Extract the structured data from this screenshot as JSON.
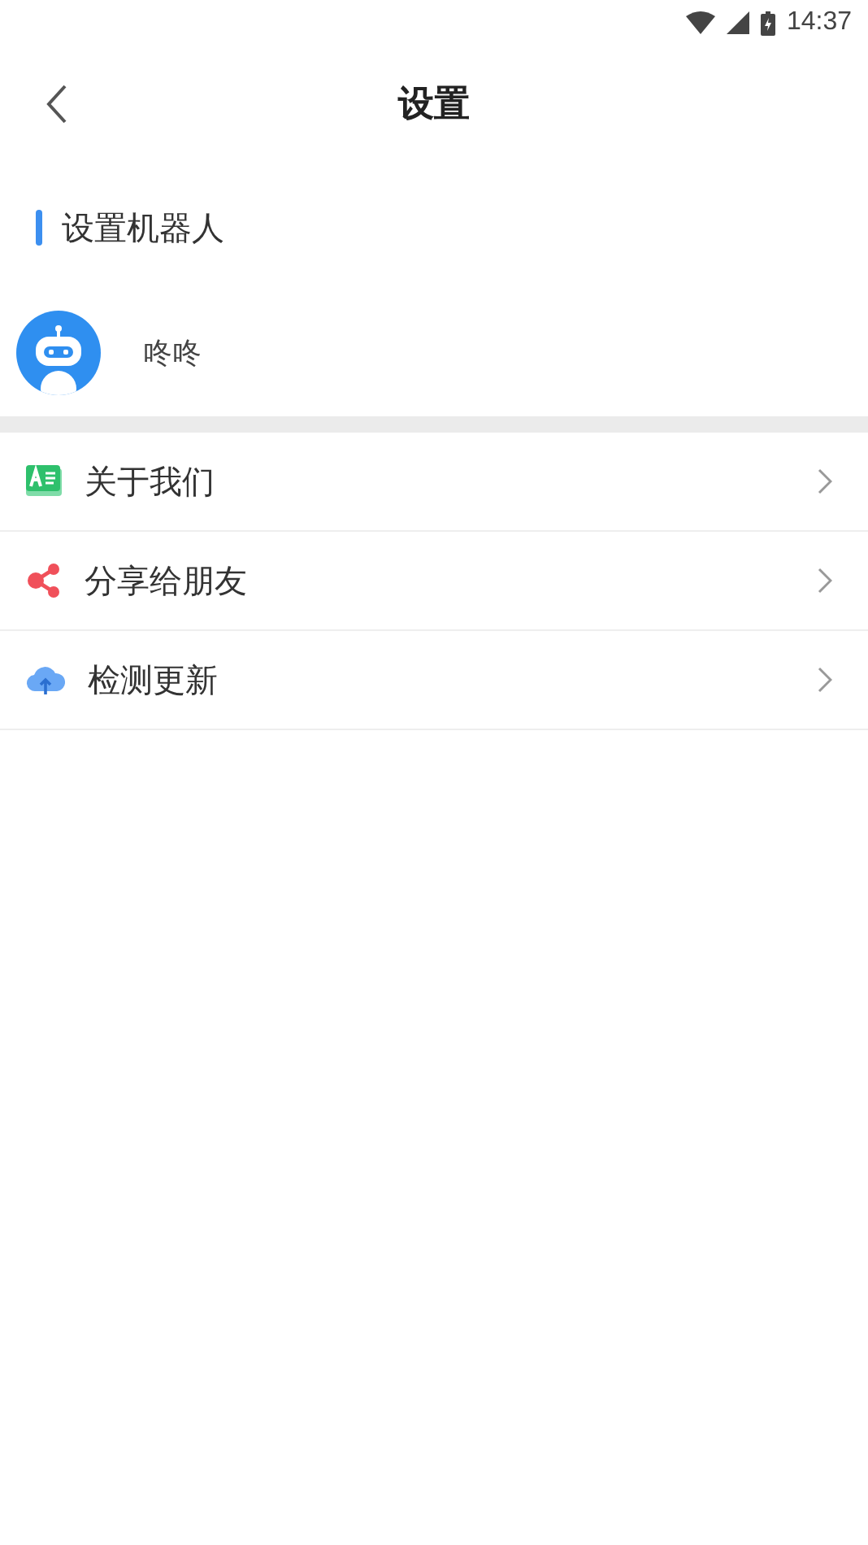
{
  "status_bar": {
    "time": "14:37"
  },
  "header": {
    "title": "设置"
  },
  "section": {
    "title": "设置机器人"
  },
  "robot": {
    "name": "咚咚"
  },
  "menu": [
    {
      "kind": "about",
      "label": "关于我们"
    },
    {
      "kind": "share",
      "label": "分享给朋友"
    },
    {
      "kind": "update",
      "label": "检测更新"
    }
  ]
}
